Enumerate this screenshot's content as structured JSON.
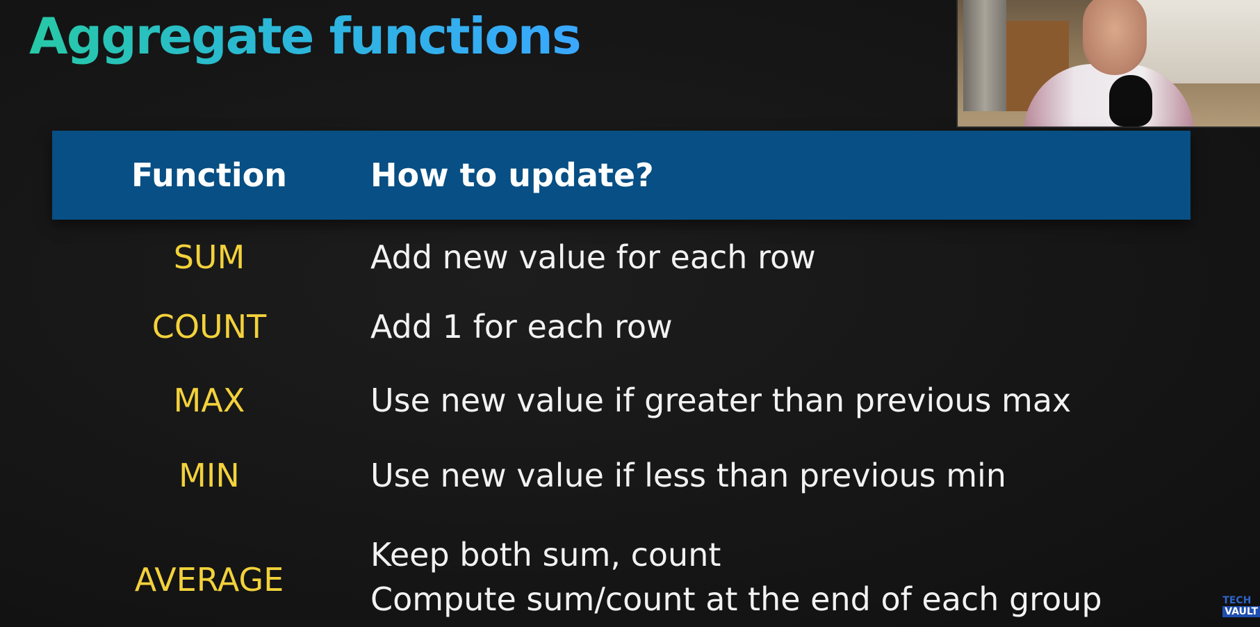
{
  "slide": {
    "title": "Aggregate functions"
  },
  "table": {
    "header": {
      "function_label": "Function",
      "how_label": "How to update?"
    },
    "rows": [
      {
        "function": "SUM",
        "how": [
          "Add new value for each row"
        ]
      },
      {
        "function": "COUNT",
        "how": [
          "Add 1 for each row"
        ]
      },
      {
        "function": "MAX",
        "how": [
          "Use new value if greater than previous max"
        ]
      },
      {
        "function": "MIN",
        "how": [
          "Use new value if less than previous min"
        ]
      },
      {
        "function": "AVERAGE",
        "how": [
          "Keep both sum, count",
          "Compute sum/count at the end of each group"
        ]
      }
    ]
  },
  "watermark": {
    "line1": "TECH",
    "line2": "VAULT"
  },
  "colors": {
    "title_gradient_start": "#27c9a6",
    "title_gradient_end": "#3aa8ff",
    "header_bg": "#074f84",
    "function_text": "#f3d23b",
    "description_text": "#f2f2f2",
    "background": "#151515"
  }
}
